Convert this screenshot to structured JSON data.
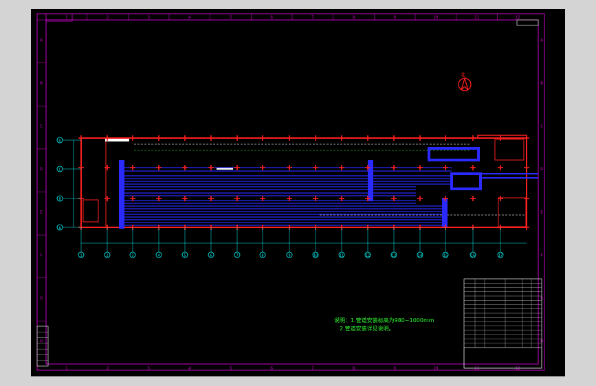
{
  "app": {
    "canvas_color": "#000000",
    "frame_color": "#cc00cc",
    "background": "#d4d4d4"
  },
  "colors": {
    "wall": "#ff2020",
    "pipe": "#2a2aff",
    "grid": "#00ffff",
    "text": "#33ff33",
    "frame": "#cc00cc"
  },
  "frame": {
    "top_ticks": [
      "1",
      "2",
      "3",
      "4",
      "5",
      "6",
      "7",
      "8",
      "9",
      "10",
      "11",
      "12"
    ],
    "bottom_ticks": [
      "1",
      "2",
      "3",
      "4",
      "5",
      "6",
      "7",
      "8",
      "9",
      "10",
      "11",
      "12"
    ],
    "side_ticks": [
      "A",
      "B",
      "C",
      "D",
      "E",
      "F",
      "G",
      "H"
    ]
  },
  "drawing": {
    "north_label": "北",
    "row_axes": [
      "D",
      "C",
      "B",
      "A"
    ],
    "column_axes": [
      "1",
      "2",
      "3",
      "4",
      "5",
      "6",
      "7",
      "8",
      "9",
      "10",
      "11",
      "12",
      "13",
      "14",
      "15",
      "16",
      "17"
    ]
  },
  "notes": {
    "line1": "说明：1.管道安装标高为980~1000mm",
    "line2": "2.管道安装详见说明。"
  },
  "title_block": {
    "rows": 16
  }
}
